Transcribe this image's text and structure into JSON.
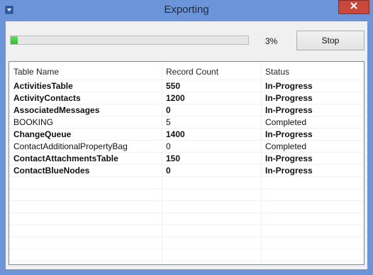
{
  "window": {
    "title": "Exporting"
  },
  "progress": {
    "value": 0.03,
    "label": "3%",
    "color": "#3fd03f"
  },
  "buttons": {
    "stop": "Stop"
  },
  "table": {
    "headers": [
      "Table Name",
      "Record Count",
      "Status"
    ],
    "rows": [
      {
        "name": "ActivitiesTable",
        "count": "550",
        "status": "In-Progress",
        "bold": true
      },
      {
        "name": "ActivityContacts",
        "count": "1200",
        "status": "In-Progress",
        "bold": true
      },
      {
        "name": "AssociatedMessages",
        "count": "0",
        "status": "In-Progress",
        "bold": true
      },
      {
        "name": "BOOKING",
        "count": "5",
        "status": "Completed",
        "bold": false
      },
      {
        "name": "ChangeQueue",
        "count": "1400",
        "status": "In-Progress",
        "bold": true
      },
      {
        "name": "ContactAdditionalPropertyBag",
        "count": "0",
        "status": "Completed",
        "bold": false
      },
      {
        "name": "ContactAttachmentsTable",
        "count": "150",
        "status": "In-Progress",
        "bold": true
      },
      {
        "name": "ContactBlueNodes",
        "count": "0",
        "status": "In-Progress",
        "bold": true
      }
    ]
  },
  "icons": {
    "app": "download-arrow-icon",
    "close": "close-icon"
  }
}
